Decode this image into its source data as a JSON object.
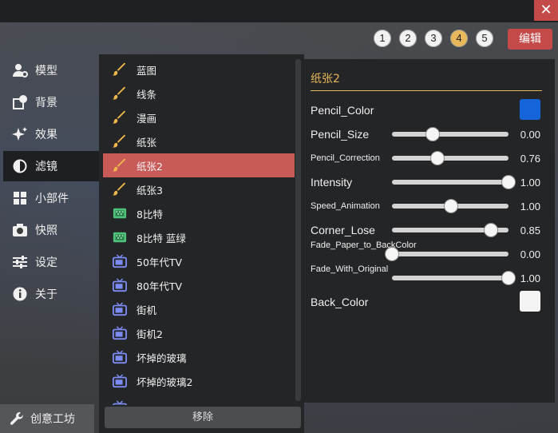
{
  "window": {
    "close_label": "✕"
  },
  "presets": {
    "buttons": [
      "1",
      "2",
      "3",
      "4",
      "5"
    ],
    "active": "4"
  },
  "edit_label": "编辑",
  "sidebar": {
    "items": [
      {
        "label": "模型",
        "icon": "user-gear-icon"
      },
      {
        "label": "背景",
        "icon": "background-icon"
      },
      {
        "label": "效果",
        "icon": "sparkle-icon"
      },
      {
        "label": "滤镜",
        "icon": "filter-icon"
      },
      {
        "label": "小部件",
        "icon": "widgets-icon"
      },
      {
        "label": "快照",
        "icon": "camera-icon"
      },
      {
        "label": "设定",
        "icon": "sliders-icon"
      },
      {
        "label": "关于",
        "icon": "info-icon"
      }
    ],
    "active": "滤镜",
    "bottom_label": "创意工坊"
  },
  "filters": {
    "items": [
      {
        "label": "蓝图",
        "icon": "brush-icon"
      },
      {
        "label": "线条",
        "icon": "brush-icon"
      },
      {
        "label": "漫画",
        "icon": "brush-icon"
      },
      {
        "label": "纸张",
        "icon": "brush-icon"
      },
      {
        "label": "纸张2",
        "icon": "brush-icon"
      },
      {
        "label": "纸张3",
        "icon": "brush-icon"
      },
      {
        "label": "8比特",
        "icon": "pixel-icon"
      },
      {
        "label": "8比特 蓝绿",
        "icon": "pixel-icon"
      },
      {
        "label": "50年代TV",
        "icon": "tv-icon"
      },
      {
        "label": "80年代TV",
        "icon": "tv-icon"
      },
      {
        "label": "街机",
        "icon": "tv-icon"
      },
      {
        "label": "街机2",
        "icon": "tv-icon"
      },
      {
        "label": "坏掉的玻璃",
        "icon": "tv-icon"
      },
      {
        "label": "坏掉的玻璃2",
        "icon": "tv-icon"
      }
    ],
    "selected": "纸张2",
    "remove_label": "移除"
  },
  "properties": {
    "title": "纸张2",
    "rows": [
      {
        "name": "Pencil_Color",
        "kind": "color",
        "color": "#1565d8"
      },
      {
        "name": "Pencil_Size",
        "kind": "slider",
        "value": "0.00",
        "level": 0.35
      },
      {
        "name": "Pencil_Correction",
        "kind": "slider",
        "value": "0.76",
        "level": 0.39
      },
      {
        "name": "Intensity",
        "kind": "slider",
        "value": "1.00",
        "level": 1.0
      },
      {
        "name": "Speed_Animation",
        "kind": "slider",
        "value": "1.00",
        "level": 0.51
      },
      {
        "name": "Corner_Lose",
        "kind": "slider",
        "value": "0.85",
        "level": 0.85
      },
      {
        "name": "Fade_Paper_to_BackColor",
        "kind": "slider",
        "value": "0.00",
        "level": 0.0
      },
      {
        "name": "Fade_With_Original",
        "kind": "slider",
        "value": "1.00",
        "level": 1.0
      },
      {
        "name": "Back_Color",
        "kind": "color",
        "color": "#f4f4f4"
      }
    ]
  },
  "colors": {
    "accent": "#e8b85a",
    "selected": "#c85a58",
    "close": "#c44a4a"
  }
}
